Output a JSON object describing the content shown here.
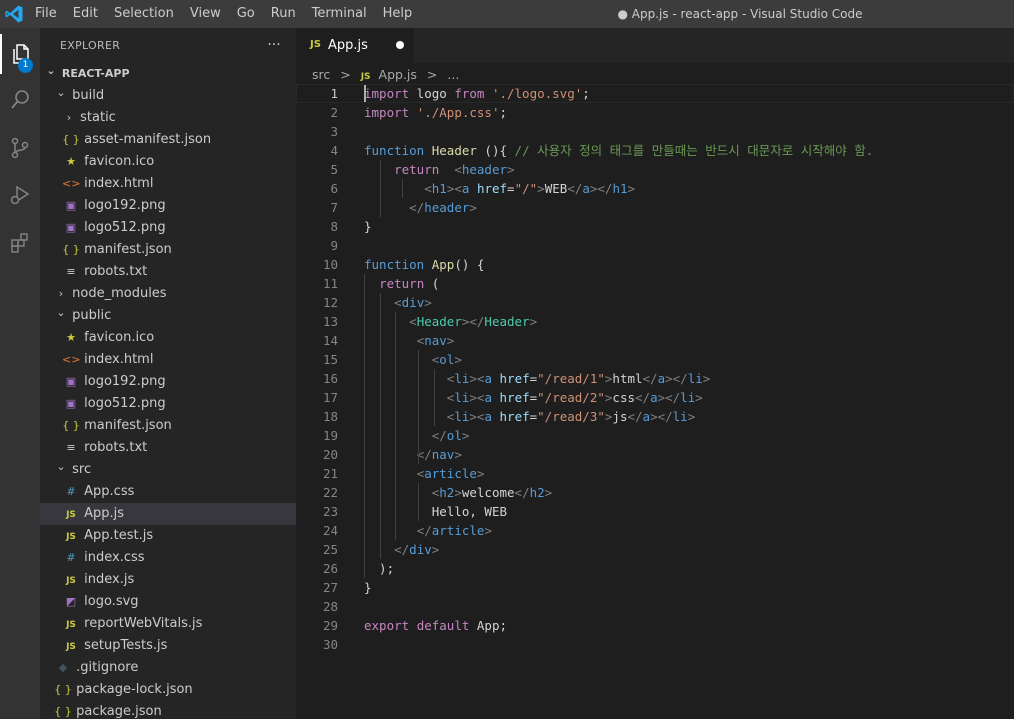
{
  "titlebar": {
    "menu": [
      "File",
      "Edit",
      "Selection",
      "View",
      "Go",
      "Run",
      "Terminal",
      "Help"
    ],
    "window_title": "● App.js - react-app - Visual Studio Code"
  },
  "activitybar": {
    "items": [
      "explorer-icon",
      "search-icon",
      "source-control-icon",
      "run-debug-icon",
      "extensions-icon"
    ],
    "explorer_badge": "1"
  },
  "explorer": {
    "title": "EXPLORER",
    "more": "···",
    "tree": [
      {
        "label": "REACT-APP",
        "depth": 0,
        "type": "root",
        "open": true
      },
      {
        "label": "build",
        "depth": 1,
        "type": "folder",
        "open": true
      },
      {
        "label": "static",
        "depth": 2,
        "type": "folder",
        "open": false
      },
      {
        "label": "asset-manifest.json",
        "depth": 2,
        "type": "json"
      },
      {
        "label": "favicon.ico",
        "depth": 2,
        "type": "ico"
      },
      {
        "label": "index.html",
        "depth": 2,
        "type": "html"
      },
      {
        "label": "logo192.png",
        "depth": 2,
        "type": "png"
      },
      {
        "label": "logo512.png",
        "depth": 2,
        "type": "png"
      },
      {
        "label": "manifest.json",
        "depth": 2,
        "type": "json"
      },
      {
        "label": "robots.txt",
        "depth": 2,
        "type": "txt"
      },
      {
        "label": "node_modules",
        "depth": 1,
        "type": "folder",
        "open": false
      },
      {
        "label": "public",
        "depth": 1,
        "type": "folder",
        "open": true
      },
      {
        "label": "favicon.ico",
        "depth": 2,
        "type": "ico"
      },
      {
        "label": "index.html",
        "depth": 2,
        "type": "html"
      },
      {
        "label": "logo192.png",
        "depth": 2,
        "type": "png"
      },
      {
        "label": "logo512.png",
        "depth": 2,
        "type": "png"
      },
      {
        "label": "manifest.json",
        "depth": 2,
        "type": "json"
      },
      {
        "label": "robots.txt",
        "depth": 2,
        "type": "txt"
      },
      {
        "label": "src",
        "depth": 1,
        "type": "folder",
        "open": true
      },
      {
        "label": "App.css",
        "depth": 2,
        "type": "css"
      },
      {
        "label": "App.js",
        "depth": 2,
        "type": "js",
        "selected": true
      },
      {
        "label": "App.test.js",
        "depth": 2,
        "type": "js"
      },
      {
        "label": "index.css",
        "depth": 2,
        "type": "css"
      },
      {
        "label": "index.js",
        "depth": 2,
        "type": "js"
      },
      {
        "label": "logo.svg",
        "depth": 2,
        "type": "svg"
      },
      {
        "label": "reportWebVitals.js",
        "depth": 2,
        "type": "js"
      },
      {
        "label": "setupTests.js",
        "depth": 2,
        "type": "js"
      },
      {
        "label": ".gitignore",
        "depth": 1,
        "type": "git"
      },
      {
        "label": "package-lock.json",
        "depth": 1,
        "type": "json"
      },
      {
        "label": "package.json",
        "depth": 1,
        "type": "json"
      }
    ]
  },
  "editor": {
    "tab": {
      "label": "App.js",
      "icon": "JS"
    },
    "breadcrumb": {
      "folder": "src",
      "sep": ">",
      "icon": "JS",
      "file": "App.js",
      "tail": "..."
    },
    "current_line": 1,
    "lines": [
      [
        [
          "import",
          "c"
        ],
        [
          " logo ",
          ""
        ],
        [
          "from",
          "c"
        ],
        [
          " ",
          ""
        ],
        [
          "'./logo.svg'",
          "s"
        ],
        [
          ";",
          ""
        ]
      ],
      [
        [
          "import",
          "c"
        ],
        [
          " ",
          ""
        ],
        [
          "'./App.css'",
          "s"
        ],
        [
          ";",
          ""
        ]
      ],
      [],
      [
        [
          "function",
          "k"
        ],
        [
          " ",
          ""
        ],
        [
          "Header",
          "f"
        ],
        [
          " (){ ",
          ""
        ],
        [
          "// 사용자 정의 태그를 만들때는 반드시 대문자로 시작해야 함.",
          "cm"
        ]
      ],
      [
        [
          "    ",
          ""
        ],
        [
          "return",
          "c"
        ],
        [
          "  ",
          ""
        ],
        [
          "<",
          "b"
        ],
        [
          "header",
          "k"
        ],
        [
          ">",
          "b"
        ]
      ],
      [
        [
          "        ",
          ""
        ],
        [
          "<",
          "b"
        ],
        [
          "h1",
          "k"
        ],
        [
          "><",
          "b"
        ],
        [
          "a",
          "k"
        ],
        [
          " ",
          ""
        ],
        [
          "href",
          "a"
        ],
        [
          "=",
          ""
        ],
        [
          "\"/\"",
          "s"
        ],
        [
          ">",
          "b"
        ],
        [
          "WEB",
          ""
        ],
        [
          "</",
          "b"
        ],
        [
          "a",
          "k"
        ],
        [
          "></",
          "b"
        ],
        [
          "h1",
          "k"
        ],
        [
          ">",
          "b"
        ]
      ],
      [
        [
          "      ",
          ""
        ],
        [
          "</",
          "b"
        ],
        [
          "header",
          "k"
        ],
        [
          ">",
          "b"
        ]
      ],
      [
        [
          "}",
          ""
        ]
      ],
      [],
      [
        [
          "function",
          "k"
        ],
        [
          " ",
          ""
        ],
        [
          "App",
          "f"
        ],
        [
          "() {",
          ""
        ]
      ],
      [
        [
          "  ",
          ""
        ],
        [
          "return",
          "c"
        ],
        [
          " (",
          ""
        ]
      ],
      [
        [
          "    ",
          ""
        ],
        [
          "<",
          "b"
        ],
        [
          "div",
          "k"
        ],
        [
          ">",
          "b"
        ]
      ],
      [
        [
          "      ",
          ""
        ],
        [
          "<",
          "b"
        ],
        [
          "Header",
          "t"
        ],
        [
          "></",
          "b"
        ],
        [
          "Header",
          "t"
        ],
        [
          ">",
          "b"
        ]
      ],
      [
        [
          "       ",
          ""
        ],
        [
          "<",
          "b"
        ],
        [
          "nav",
          "k"
        ],
        [
          ">",
          "b"
        ]
      ],
      [
        [
          "         ",
          ""
        ],
        [
          "<",
          "b"
        ],
        [
          "ol",
          "k"
        ],
        [
          ">",
          "b"
        ]
      ],
      [
        [
          "           ",
          ""
        ],
        [
          "<",
          "b"
        ],
        [
          "li",
          "k"
        ],
        [
          "><",
          "b"
        ],
        [
          "a",
          "k"
        ],
        [
          " ",
          ""
        ],
        [
          "href",
          "a"
        ],
        [
          "=",
          ""
        ],
        [
          "\"/read/1\"",
          "s"
        ],
        [
          ">",
          "b"
        ],
        [
          "html",
          ""
        ],
        [
          "</",
          "b"
        ],
        [
          "a",
          "k"
        ],
        [
          "></",
          "b"
        ],
        [
          "li",
          "k"
        ],
        [
          ">",
          "b"
        ]
      ],
      [
        [
          "           ",
          ""
        ],
        [
          "<",
          "b"
        ],
        [
          "li",
          "k"
        ],
        [
          "><",
          "b"
        ],
        [
          "a",
          "k"
        ],
        [
          " ",
          ""
        ],
        [
          "href",
          "a"
        ],
        [
          "=",
          ""
        ],
        [
          "\"/read/2\"",
          "s"
        ],
        [
          ">",
          "b"
        ],
        [
          "css",
          ""
        ],
        [
          "</",
          "b"
        ],
        [
          "a",
          "k"
        ],
        [
          "></",
          "b"
        ],
        [
          "li",
          "k"
        ],
        [
          ">",
          "b"
        ]
      ],
      [
        [
          "           ",
          ""
        ],
        [
          "<",
          "b"
        ],
        [
          "li",
          "k"
        ],
        [
          "><",
          "b"
        ],
        [
          "a",
          "k"
        ],
        [
          " ",
          ""
        ],
        [
          "href",
          "a"
        ],
        [
          "=",
          ""
        ],
        [
          "\"/read/3\"",
          "s"
        ],
        [
          ">",
          "b"
        ],
        [
          "js",
          ""
        ],
        [
          "</",
          "b"
        ],
        [
          "a",
          "k"
        ],
        [
          "></",
          "b"
        ],
        [
          "li",
          "k"
        ],
        [
          ">",
          "b"
        ]
      ],
      [
        [
          "         ",
          ""
        ],
        [
          "</",
          "b"
        ],
        [
          "ol",
          "k"
        ],
        [
          ">",
          "b"
        ]
      ],
      [
        [
          "       ",
          ""
        ],
        [
          "</",
          "b"
        ],
        [
          "nav",
          "k"
        ],
        [
          ">",
          "b"
        ]
      ],
      [
        [
          "       ",
          ""
        ],
        [
          "<",
          "b"
        ],
        [
          "article",
          "k"
        ],
        [
          ">",
          "b"
        ]
      ],
      [
        [
          "         ",
          ""
        ],
        [
          "<",
          "b"
        ],
        [
          "h2",
          "k"
        ],
        [
          ">",
          "b"
        ],
        [
          "welcome",
          ""
        ],
        [
          "</",
          "b"
        ],
        [
          "h2",
          "k"
        ],
        [
          ">",
          "b"
        ]
      ],
      [
        [
          "         ",
          ""
        ],
        [
          "Hello, WEB",
          ""
        ]
      ],
      [
        [
          "       ",
          ""
        ],
        [
          "</",
          "b"
        ],
        [
          "article",
          "k"
        ],
        [
          ">",
          "b"
        ]
      ],
      [
        [
          "    ",
          ""
        ],
        [
          "</",
          "b"
        ],
        [
          "div",
          "k"
        ],
        [
          ">",
          "b"
        ]
      ],
      [
        [
          "  );",
          ""
        ]
      ],
      [
        [
          "}",
          ""
        ]
      ],
      [],
      [
        [
          "export",
          "c"
        ],
        [
          " ",
          ""
        ],
        [
          "default",
          "c"
        ],
        [
          " App;",
          ""
        ]
      ],
      []
    ]
  }
}
